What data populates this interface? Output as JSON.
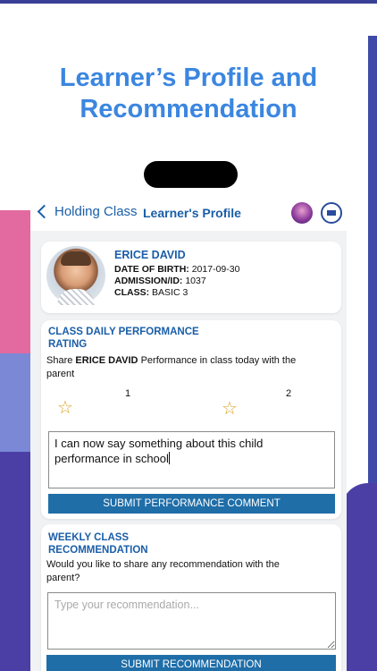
{
  "headline": {
    "line1": "Learner’s Profile and",
    "line2": "Recommendation"
  },
  "nav": {
    "back_label": "Holding Class",
    "title": "Learner's Profile"
  },
  "profile": {
    "name": "ERICE DAVID",
    "dob_label": "DATE OF BIRTH:",
    "dob": "2017-09-30",
    "admission_label": "ADMISSION/ID:",
    "admission_id": "1037",
    "class_label": "CLASS:",
    "class_value": "BASIC 3"
  },
  "rating": {
    "title_line1": "CLASS DAILY PERFORMANCE",
    "title_line2": "RATING",
    "prompt_before": "Share",
    "prompt_name": "ERICE DAVID",
    "prompt_after": "Performance in class today with the",
    "prompt_line2": "parent",
    "labels": [
      "1",
      "2"
    ],
    "star_icon": "☆",
    "comment_line1": "I can now say something about this child",
    "comment_line2": "performance in school",
    "submit_label": "SUBMIT PERFORMANCE COMMENT"
  },
  "recommendation": {
    "title_line1": "WEEKLY CLASS",
    "title_line2": "RECOMMENDATION",
    "prompt_line1": "Would you like to share any recommendation with the",
    "prompt_line2": "parent?",
    "placeholder": "Type your recommendation...",
    "submit_label": "SUBMIT RECOMMENDATION"
  },
  "colors": {
    "accent_blue": "#1a5ea8",
    "headline_blue": "#3b86e0",
    "button_blue": "#1f6ea8",
    "star_gold": "#d9a324"
  }
}
